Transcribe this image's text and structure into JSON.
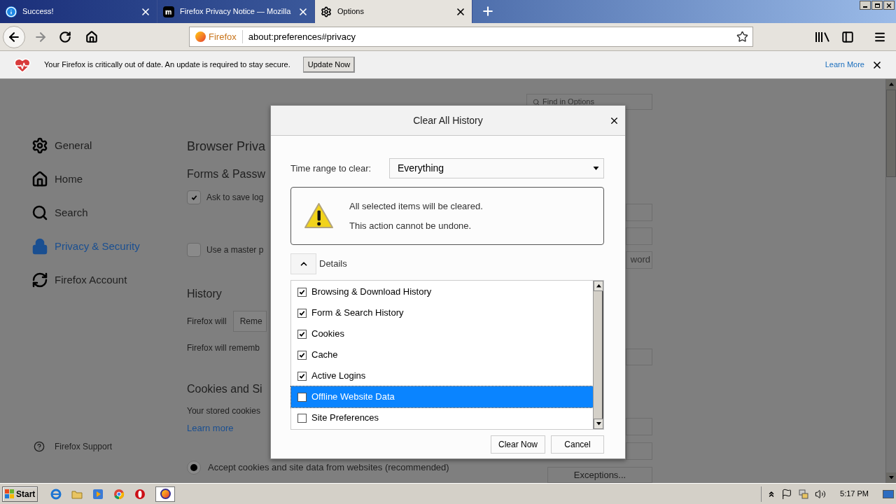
{
  "tabs": [
    {
      "kind": "info",
      "title": "Success!",
      "selected": false
    },
    {
      "kind": "mozilla",
      "title": "Firefox Privacy Notice — Mozilla",
      "selected": false
    },
    {
      "kind": "gear",
      "title": "Options",
      "selected": true
    }
  ],
  "toolbar": {
    "identity": "Firefox",
    "url": "about:preferences#privacy"
  },
  "notification": {
    "message": "Your Firefox is critically out of date. An update is required to stay secure.",
    "button": "Update Now",
    "link": "Learn More"
  },
  "search": {
    "placeholder": "Find in Options"
  },
  "sidebar": {
    "items": [
      {
        "kind": "gear",
        "label": "General",
        "selected": false
      },
      {
        "kind": "home",
        "label": "Home",
        "selected": false
      },
      {
        "kind": "search",
        "label": "Search",
        "selected": false
      },
      {
        "kind": "lock",
        "label": "Privacy & Security",
        "selected": true
      },
      {
        "kind": "sync",
        "label": "Firefox Account",
        "selected": false
      }
    ],
    "support": "Firefox Support"
  },
  "page": {
    "title": "Browser Priva",
    "forms_heading": "Forms & Passw",
    "ask_to_save": {
      "label": "Ask to save log",
      "checked": true
    },
    "master_password": {
      "label": "Use a master p",
      "checked": false
    },
    "history_heading": "History",
    "history_label": "Firefox will",
    "history_select": "Reme",
    "history_note": "Firefox will rememb",
    "cookies_heading": "Cookies and Si",
    "cookies_text": "Your stored cookies",
    "cookies_link": "Learn more",
    "accept_cookies": {
      "label": "Accept cookies and site data from websites (recommended)",
      "selected": true
    },
    "side_buttons": [
      "word",
      "Exceptions..."
    ]
  },
  "dialog": {
    "title": "Clear All History",
    "time_range_label": "Time range to clear:",
    "time_range": "Everything",
    "warning": [
      "All selected items will be cleared.",
      "This action cannot be undone."
    ],
    "details": {
      "label": "Details",
      "expanded": true
    },
    "items": [
      {
        "label": "Browsing & Download History",
        "checked": true,
        "selected": false
      },
      {
        "label": "Form & Search History",
        "checked": true,
        "selected": false
      },
      {
        "label": "Cookies",
        "checked": true,
        "selected": false
      },
      {
        "label": "Cache",
        "checked": true,
        "selected": false
      },
      {
        "label": "Active Logins",
        "checked": true,
        "selected": false
      },
      {
        "label": "Offline Website Data",
        "checked": false,
        "selected": true
      },
      {
        "label": "Site Preferences",
        "checked": false,
        "selected": false
      }
    ],
    "buttons": [
      "Clear Now",
      "Cancel"
    ]
  },
  "taskbar": {
    "start": "Start",
    "clock": "5:17 PM"
  }
}
